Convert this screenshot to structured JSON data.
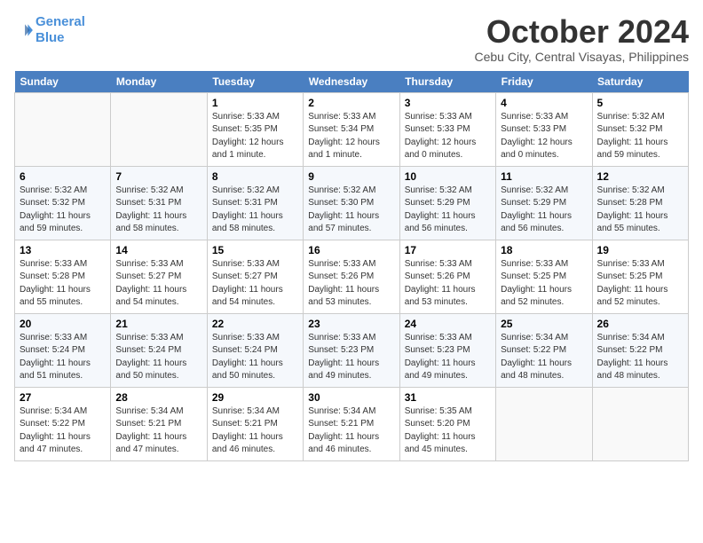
{
  "header": {
    "logo_line1": "General",
    "logo_line2": "Blue",
    "month": "October 2024",
    "location": "Cebu City, Central Visayas, Philippines"
  },
  "weekdays": [
    "Sunday",
    "Monday",
    "Tuesday",
    "Wednesday",
    "Thursday",
    "Friday",
    "Saturday"
  ],
  "weeks": [
    [
      {
        "day": "",
        "info": ""
      },
      {
        "day": "",
        "info": ""
      },
      {
        "day": "1",
        "info": "Sunrise: 5:33 AM\nSunset: 5:35 PM\nDaylight: 12 hours\nand 1 minute."
      },
      {
        "day": "2",
        "info": "Sunrise: 5:33 AM\nSunset: 5:34 PM\nDaylight: 12 hours\nand 1 minute."
      },
      {
        "day": "3",
        "info": "Sunrise: 5:33 AM\nSunset: 5:33 PM\nDaylight: 12 hours\nand 0 minutes."
      },
      {
        "day": "4",
        "info": "Sunrise: 5:33 AM\nSunset: 5:33 PM\nDaylight: 12 hours\nand 0 minutes."
      },
      {
        "day": "5",
        "info": "Sunrise: 5:32 AM\nSunset: 5:32 PM\nDaylight: 11 hours\nand 59 minutes."
      }
    ],
    [
      {
        "day": "6",
        "info": "Sunrise: 5:32 AM\nSunset: 5:32 PM\nDaylight: 11 hours\nand 59 minutes."
      },
      {
        "day": "7",
        "info": "Sunrise: 5:32 AM\nSunset: 5:31 PM\nDaylight: 11 hours\nand 58 minutes."
      },
      {
        "day": "8",
        "info": "Sunrise: 5:32 AM\nSunset: 5:31 PM\nDaylight: 11 hours\nand 58 minutes."
      },
      {
        "day": "9",
        "info": "Sunrise: 5:32 AM\nSunset: 5:30 PM\nDaylight: 11 hours\nand 57 minutes."
      },
      {
        "day": "10",
        "info": "Sunrise: 5:32 AM\nSunset: 5:29 PM\nDaylight: 11 hours\nand 56 minutes."
      },
      {
        "day": "11",
        "info": "Sunrise: 5:32 AM\nSunset: 5:29 PM\nDaylight: 11 hours\nand 56 minutes."
      },
      {
        "day": "12",
        "info": "Sunrise: 5:32 AM\nSunset: 5:28 PM\nDaylight: 11 hours\nand 55 minutes."
      }
    ],
    [
      {
        "day": "13",
        "info": "Sunrise: 5:33 AM\nSunset: 5:28 PM\nDaylight: 11 hours\nand 55 minutes."
      },
      {
        "day": "14",
        "info": "Sunrise: 5:33 AM\nSunset: 5:27 PM\nDaylight: 11 hours\nand 54 minutes."
      },
      {
        "day": "15",
        "info": "Sunrise: 5:33 AM\nSunset: 5:27 PM\nDaylight: 11 hours\nand 54 minutes."
      },
      {
        "day": "16",
        "info": "Sunrise: 5:33 AM\nSunset: 5:26 PM\nDaylight: 11 hours\nand 53 minutes."
      },
      {
        "day": "17",
        "info": "Sunrise: 5:33 AM\nSunset: 5:26 PM\nDaylight: 11 hours\nand 53 minutes."
      },
      {
        "day": "18",
        "info": "Sunrise: 5:33 AM\nSunset: 5:25 PM\nDaylight: 11 hours\nand 52 minutes."
      },
      {
        "day": "19",
        "info": "Sunrise: 5:33 AM\nSunset: 5:25 PM\nDaylight: 11 hours\nand 52 minutes."
      }
    ],
    [
      {
        "day": "20",
        "info": "Sunrise: 5:33 AM\nSunset: 5:24 PM\nDaylight: 11 hours\nand 51 minutes."
      },
      {
        "day": "21",
        "info": "Sunrise: 5:33 AM\nSunset: 5:24 PM\nDaylight: 11 hours\nand 50 minutes."
      },
      {
        "day": "22",
        "info": "Sunrise: 5:33 AM\nSunset: 5:24 PM\nDaylight: 11 hours\nand 50 minutes."
      },
      {
        "day": "23",
        "info": "Sunrise: 5:33 AM\nSunset: 5:23 PM\nDaylight: 11 hours\nand 49 minutes."
      },
      {
        "day": "24",
        "info": "Sunrise: 5:33 AM\nSunset: 5:23 PM\nDaylight: 11 hours\nand 49 minutes."
      },
      {
        "day": "25",
        "info": "Sunrise: 5:34 AM\nSunset: 5:22 PM\nDaylight: 11 hours\nand 48 minutes."
      },
      {
        "day": "26",
        "info": "Sunrise: 5:34 AM\nSunset: 5:22 PM\nDaylight: 11 hours\nand 48 minutes."
      }
    ],
    [
      {
        "day": "27",
        "info": "Sunrise: 5:34 AM\nSunset: 5:22 PM\nDaylight: 11 hours\nand 47 minutes."
      },
      {
        "day": "28",
        "info": "Sunrise: 5:34 AM\nSunset: 5:21 PM\nDaylight: 11 hours\nand 47 minutes."
      },
      {
        "day": "29",
        "info": "Sunrise: 5:34 AM\nSunset: 5:21 PM\nDaylight: 11 hours\nand 46 minutes."
      },
      {
        "day": "30",
        "info": "Sunrise: 5:34 AM\nSunset: 5:21 PM\nDaylight: 11 hours\nand 46 minutes."
      },
      {
        "day": "31",
        "info": "Sunrise: 5:35 AM\nSunset: 5:20 PM\nDaylight: 11 hours\nand 45 minutes."
      },
      {
        "day": "",
        "info": ""
      },
      {
        "day": "",
        "info": ""
      }
    ]
  ]
}
